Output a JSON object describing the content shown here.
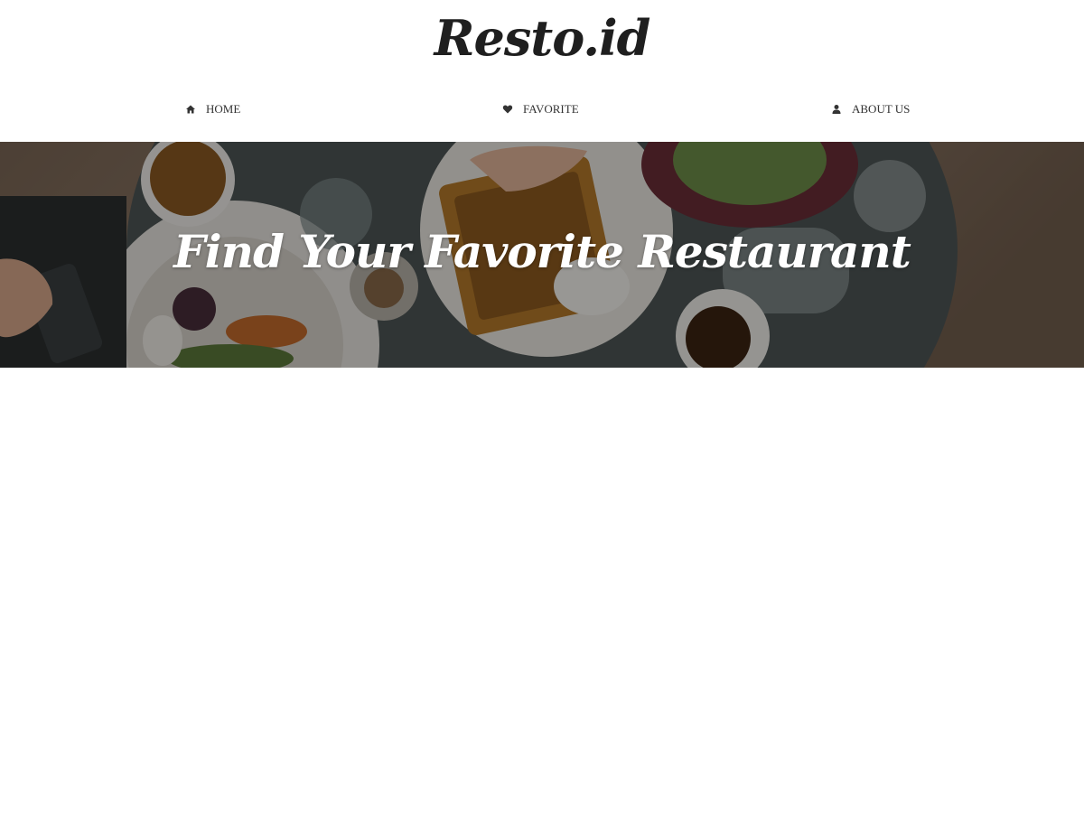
{
  "header": {
    "brand": "Resto.id"
  },
  "nav": {
    "items": [
      {
        "label": "HOME",
        "icon": "home-icon"
      },
      {
        "label": "FAVORITE",
        "icon": "heart-icon"
      },
      {
        "label": "ABOUT US",
        "icon": "user-icon"
      }
    ]
  },
  "hero": {
    "title": "Find Your Favorite Restaurant"
  },
  "colors": {
    "text": "#333333",
    "brand": "#1f1f1f",
    "hero_text": "#ffffff",
    "background": "#ffffff"
  }
}
